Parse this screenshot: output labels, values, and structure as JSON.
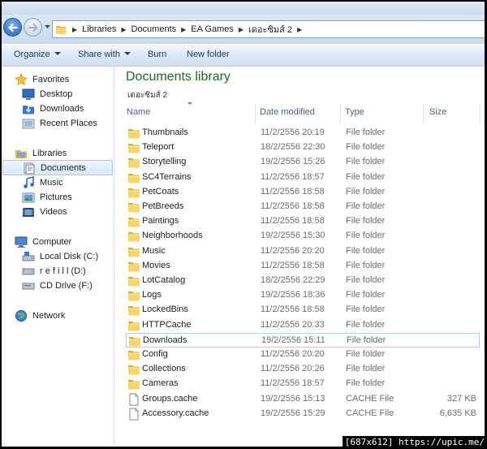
{
  "address_bar": {
    "crumbs": [
      "Libraries",
      "Documents",
      "EA Games",
      "เดอะซิมส์ 2"
    ]
  },
  "command_bar": {
    "organize": "Organize",
    "share_with": "Share with",
    "burn": "Burn",
    "new_folder": "New folder"
  },
  "navigation": {
    "favorites": {
      "label": "Favorites",
      "items": [
        "Desktop",
        "Downloads",
        "Recent Places"
      ]
    },
    "libraries": {
      "label": "Libraries",
      "items": [
        "Documents",
        "Music",
        "Pictures",
        "Videos"
      ],
      "selected": "Documents"
    },
    "computer": {
      "label": "Computer",
      "items": [
        "Local Disk (C:)",
        "r e f i l l (D:)",
        "CD Drive (F:)"
      ]
    },
    "network": {
      "label": "Network"
    }
  },
  "library": {
    "title": "Documents library",
    "subtitle": "เดอะซิมส์ 2"
  },
  "columns": {
    "name": "Name",
    "date": "Date modified",
    "type": "Type",
    "size": "Size"
  },
  "files": [
    {
      "name": "Thumbnails",
      "date": "11/2/2556 20:19",
      "type": "File folder",
      "size": "",
      "icon": "folder-icon"
    },
    {
      "name": "Teleport",
      "date": "18/2/2556 22:30",
      "type": "File folder",
      "size": "",
      "icon": "folder-icon"
    },
    {
      "name": "Storytelling",
      "date": "19/2/2556 15:26",
      "type": "File folder",
      "size": "",
      "icon": "folder-icon"
    },
    {
      "name": "SC4Terrains",
      "date": "11/2/2556 18:57",
      "type": "File folder",
      "size": "",
      "icon": "folder-icon"
    },
    {
      "name": "PetCoats",
      "date": "11/2/2556 18:58",
      "type": "File folder",
      "size": "",
      "icon": "folder-icon"
    },
    {
      "name": "PetBreeds",
      "date": "11/2/2556 18:58",
      "type": "File folder",
      "size": "",
      "icon": "folder-icon"
    },
    {
      "name": "Paintings",
      "date": "11/2/2556 18:58",
      "type": "File folder",
      "size": "",
      "icon": "folder-icon"
    },
    {
      "name": "Neighborhoods",
      "date": "19/2/2556 15:30",
      "type": "File folder",
      "size": "",
      "icon": "folder-icon"
    },
    {
      "name": "Music",
      "date": "11/2/2556 20:20",
      "type": "File folder",
      "size": "",
      "icon": "folder-icon"
    },
    {
      "name": "Movies",
      "date": "11/2/2556 18:58",
      "type": "File folder",
      "size": "",
      "icon": "folder-icon"
    },
    {
      "name": "LotCatalog",
      "date": "18/2/2556 22:29",
      "type": "File folder",
      "size": "",
      "icon": "folder-icon"
    },
    {
      "name": "Logs",
      "date": "19/2/2556 18:36",
      "type": "File folder",
      "size": "",
      "icon": "folder-icon"
    },
    {
      "name": "LockedBins",
      "date": "11/2/2556 18:58",
      "type": "File folder",
      "size": "",
      "icon": "folder-icon"
    },
    {
      "name": "HTTPCache",
      "date": "11/2/2556 20:33",
      "type": "File folder",
      "size": "",
      "icon": "folder-icon"
    },
    {
      "name": "Downloads",
      "date": "19/2/2556 15:11",
      "type": "File folder",
      "size": "",
      "icon": "folder-icon",
      "selected": true
    },
    {
      "name": "Config",
      "date": "11/2/2556 20:20",
      "type": "File folder",
      "size": "",
      "icon": "folder-icon"
    },
    {
      "name": "Collections",
      "date": "11/2/2556 20:26",
      "type": "File folder",
      "size": "",
      "icon": "folder-icon"
    },
    {
      "name": "Cameras",
      "date": "11/2/2556 18:57",
      "type": "File folder",
      "size": "",
      "icon": "folder-icon"
    },
    {
      "name": "Groups.cache",
      "date": "19/2/2556 15:13",
      "type": "CACHE File",
      "size": "327 KB",
      "icon": "file-icon"
    },
    {
      "name": "Accessory.cache",
      "date": "19/2/2556 15:29",
      "type": "CACHE File",
      "size": "6,635 KB",
      "icon": "file-icon"
    }
  ],
  "watermark": "[687x612] https://upic.me/"
}
